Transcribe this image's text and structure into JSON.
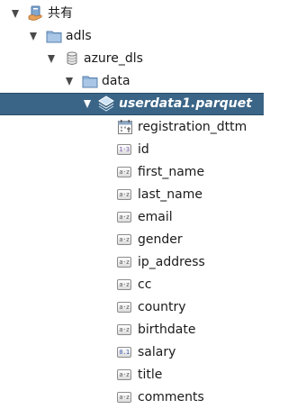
{
  "tree": {
    "root": {
      "label": "共有",
      "icon": "shared-folder-icon"
    },
    "folder": {
      "label": "adls",
      "icon": "folder-icon"
    },
    "datasource": {
      "label": "azure_dls",
      "icon": "database-icon"
    },
    "subfolder": {
      "label": "data",
      "icon": "folder-icon"
    },
    "dataset": {
      "label": "userdata1.parquet",
      "icon": "dataset-icon"
    },
    "columns": [
      {
        "label": "registration_dttm",
        "type_icon": "timestamp-icon",
        "badge": ""
      },
      {
        "label": "id",
        "type_icon": "integer-type-icon",
        "badge": "1·3"
      },
      {
        "label": "first_name",
        "type_icon": "string-type-icon",
        "badge": "a·z"
      },
      {
        "label": "last_name",
        "type_icon": "string-type-icon",
        "badge": "a·z"
      },
      {
        "label": "email",
        "type_icon": "string-type-icon",
        "badge": "a·z"
      },
      {
        "label": "gender",
        "type_icon": "string-type-icon",
        "badge": "a·z"
      },
      {
        "label": "ip_address",
        "type_icon": "string-type-icon",
        "badge": "a·z"
      },
      {
        "label": "cc",
        "type_icon": "string-type-icon",
        "badge": "a·z"
      },
      {
        "label": "country",
        "type_icon": "string-type-icon",
        "badge": "a·z"
      },
      {
        "label": "birthdate",
        "type_icon": "string-type-icon",
        "badge": "a·z"
      },
      {
        "label": "salary",
        "type_icon": "decimal-type-icon",
        "badge": "0.1"
      },
      {
        "label": "title",
        "type_icon": "string-type-icon",
        "badge": "a·z"
      },
      {
        "label": "comments",
        "type_icon": "string-type-icon",
        "badge": "a·z"
      }
    ]
  },
  "colors": {
    "selection_background": "#3b6587",
    "selection_text": "#ffffff",
    "folder": "#8fb3d9",
    "text": "#1a1a1a"
  }
}
